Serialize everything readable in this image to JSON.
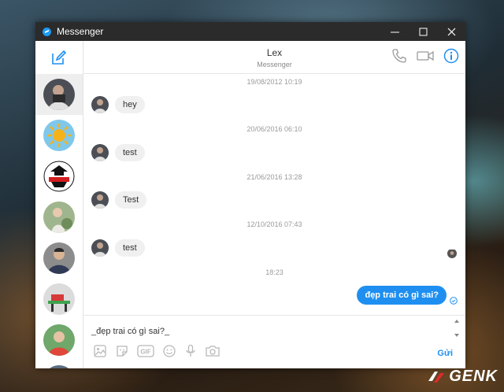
{
  "window": {
    "title": "Messenger"
  },
  "header": {
    "name": "Lex",
    "subtitle": "Messenger"
  },
  "messages": [
    {
      "time": "19/08/2012 10:19",
      "text": "hey"
    },
    {
      "time": "20/06/2016 06:10",
      "text": "test"
    },
    {
      "time": "21/06/2016 13:28",
      "text": "Test"
    },
    {
      "time": "12/10/2016 07:43",
      "text": "test"
    }
  ],
  "outgoing": {
    "time": "18:23",
    "text": "đẹp trai có gì sai?"
  },
  "composer": {
    "value": "_đẹp trai có gì sai?_",
    "send_label": "Gửi",
    "gif_label": "GIF"
  },
  "watermark": {
    "text": "GENK"
  },
  "colors": {
    "accent": "#1e8ff0",
    "titlebar": "#2b2b2b",
    "bubble_in": "#f1f0f0"
  },
  "icons": {
    "compose": "compose-icon",
    "call": "phone-icon",
    "video": "video-camera-icon",
    "info": "info-icon",
    "tools": [
      "image-icon",
      "sticker-icon",
      "gif-icon",
      "emoji-icon",
      "microphone-icon",
      "camera-icon"
    ]
  }
}
